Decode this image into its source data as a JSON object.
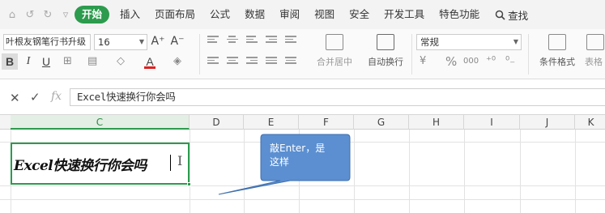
{
  "quick_access": [
    "⌂",
    "↺",
    "↻",
    "▿"
  ],
  "menu": {
    "items": [
      "开始",
      "插入",
      "页面布局",
      "公式",
      "数据",
      "审阅",
      "视图",
      "安全",
      "开发工具",
      "特色功能"
    ],
    "active": "开始",
    "search_label": "查找"
  },
  "ribbon": {
    "font_name": "叶根友钢笔行书升级",
    "font_size": "16",
    "grow_font": "A⁺",
    "shrink_font": "A⁻",
    "bold": "B",
    "italic": "I",
    "underline": "U",
    "font_color_glyph": "A",
    "merge_label": "合并居中",
    "wrap_label": "自动换行",
    "number_format": "常规",
    "percent": "%",
    "thousands": "000",
    "conditional_format_label": "条件格式",
    "table_style_label": "表格"
  },
  "formula_bar": {
    "cancel": "✕",
    "confirm": "✓",
    "fx": "fx",
    "value": "Excel快速换行你会吗"
  },
  "columns": [
    "C",
    "D",
    "E",
    "F",
    "G",
    "H",
    "I",
    "J",
    "K"
  ],
  "selected_column": "C",
  "cell": {
    "text": "Excel快速换行你会吗",
    "cursor": "I"
  },
  "callout": {
    "line1": "敲Enter，是",
    "line2": "这样"
  },
  "colors": {
    "accent": "#2c9b4d",
    "callout_fill": "#5b8fd1",
    "callout_stroke": "#3f6fad",
    "font_color_bar": "#e02020"
  }
}
